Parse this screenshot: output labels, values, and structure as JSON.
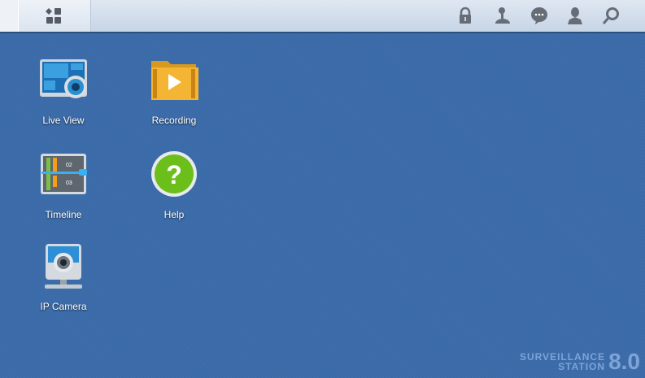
{
  "taskbar": {
    "icons": [
      "main-menu-icon",
      "lock-icon",
      "user-activity-icon",
      "notification-icon",
      "user-icon",
      "search-icon"
    ]
  },
  "apps": [
    {
      "label": "Live View"
    },
    {
      "label": "Recording"
    },
    {
      "label": "Timeline"
    },
    {
      "label": "Help"
    },
    {
      "label": "IP Camera"
    }
  ],
  "timeline_labels": [
    "02",
    "03"
  ],
  "brand": {
    "line1": "SURVEILLANCE",
    "line2": "STATION",
    "version": "8.0"
  }
}
